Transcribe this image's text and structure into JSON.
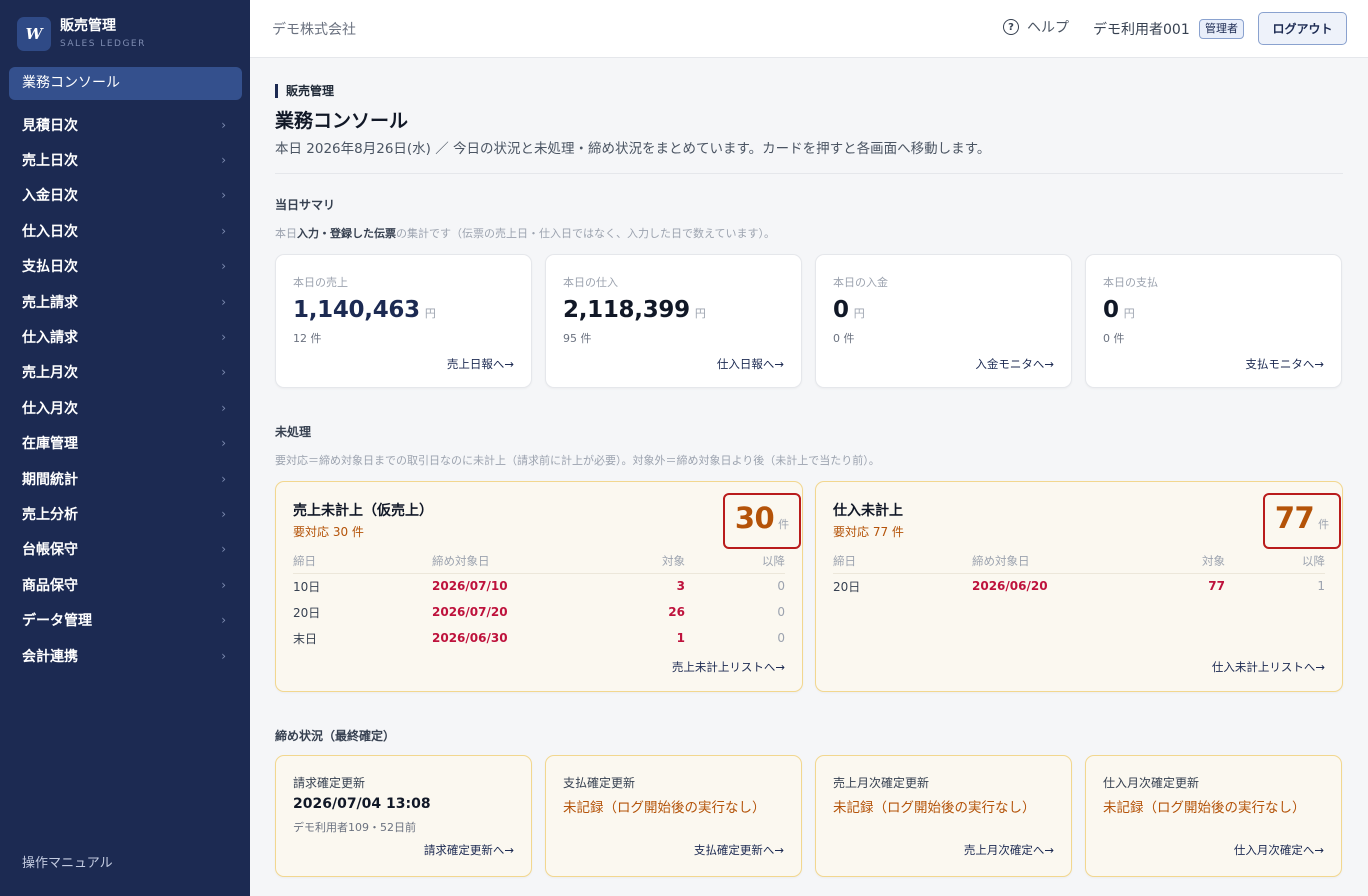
{
  "brand": {
    "logo": "W",
    "title": "販売管理",
    "subtitle": "SALES LEDGER"
  },
  "sidebar": {
    "active": "業務コンソール",
    "items": [
      {
        "label": "見積日次"
      },
      {
        "label": "売上日次"
      },
      {
        "label": "入金日次"
      },
      {
        "label": "仕入日次"
      },
      {
        "label": "支払日次"
      },
      {
        "label": "売上請求"
      },
      {
        "label": "仕入請求"
      },
      {
        "label": "売上月次"
      },
      {
        "label": "仕入月次"
      },
      {
        "label": "在庫管理"
      },
      {
        "label": "期間統計"
      },
      {
        "label": "売上分析"
      },
      {
        "label": "台帳保守"
      },
      {
        "label": "商品保守"
      },
      {
        "label": "データ管理"
      },
      {
        "label": "会計連携"
      }
    ],
    "chevron": "›",
    "manual": "操作マニュアル"
  },
  "header": {
    "company": "デモ株式会社",
    "help_icon": "?",
    "help": "ヘルプ",
    "user": "デモ利用者001",
    "role": "管理者",
    "logout": "ログアウト"
  },
  "page": {
    "crumb": "販売管理",
    "title": "業務コンソール",
    "description": "本日 2026年8月26日(水) ／ 今日の状況と未処理・締め状況をまとめています。カードを押すと各画面へ移動します。"
  },
  "summary": {
    "title": "当日サマリ",
    "note_prefix": "本日",
    "note_bold": "入力・登録した伝票",
    "note_suffix": "の集計です（伝票の売上日・仕入日ではなく、入力した日で数えています）。",
    "cards": [
      {
        "label": "本日の売上",
        "value": "1,140,463",
        "unit": "円",
        "count": "12 件",
        "link": "売上日報へ→",
        "color": "#1c2a52"
      },
      {
        "label": "本日の仕入",
        "value": "2,118,399",
        "unit": "円",
        "count": "95 件",
        "link": "仕入日報へ→",
        "color": "#111827"
      },
      {
        "label": "本日の入金",
        "value": "0",
        "unit": "円",
        "count": "0 件",
        "link": "入金モニタへ→",
        "color": "#111827"
      },
      {
        "label": "本日の支払",
        "value": "0",
        "unit": "円",
        "count": "0 件",
        "link": "支払モニタへ→",
        "color": "#111827"
      }
    ]
  },
  "pending": {
    "title": "未処理",
    "note": "要対応＝締め対象日までの取引日なのに未計上（請求前に計上が必要）。対象外＝締め対象日より後（未計上で当たり前）。",
    "columns": [
      "締日",
      "締め対象日",
      "対象",
      "以降"
    ],
    "cards": [
      {
        "title": "売上未計上（仮売上）",
        "subtitle": "要対応 30 件",
        "count": "30",
        "unit": "件",
        "rows": [
          {
            "close_day": "10日",
            "target_date": "2026/07/10",
            "target": "3",
            "after": "0"
          },
          {
            "close_day": "20日",
            "target_date": "2026/07/20",
            "target": "26",
            "after": "0"
          },
          {
            "close_day": "末日",
            "target_date": "2026/06/30",
            "target": "1",
            "after": "0"
          }
        ],
        "link": "売上未計上リストへ→"
      },
      {
        "title": "仕入未計上",
        "subtitle": "要対応 77 件",
        "count": "77",
        "unit": "件",
        "rows": [
          {
            "close_day": "20日",
            "target_date": "2026/06/20",
            "target": "77",
            "after": "1"
          }
        ],
        "link": "仕入未計上リストへ→"
      }
    ]
  },
  "closing": {
    "title": "締め状況（最終確定）",
    "cards": [
      {
        "label": "請求確定更新",
        "value": "2026/07/04 13:08",
        "meta": "デモ利用者109・52日前",
        "link": "請求確定更新へ→"
      },
      {
        "label": "支払確定更新",
        "value": "未記録（ログ開始後の実行なし）",
        "meta": "",
        "link": "支払確定更新へ→"
      },
      {
        "label": "売上月次確定更新",
        "value": "未記録（ログ開始後の実行なし）",
        "meta": "",
        "link": "売上月次確定へ→"
      },
      {
        "label": "仕入月次確定更新",
        "value": "未記録（ログ開始後の実行なし）",
        "meta": "",
        "link": "仕入月次確定へ→"
      }
    ]
  }
}
